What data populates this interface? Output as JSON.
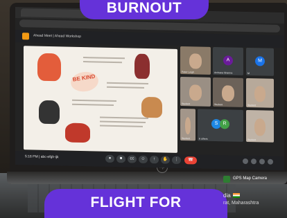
{
  "banners": {
    "top_text": "BURNOUT",
    "bottom_text": "FLIGHT FOR"
  },
  "meet": {
    "title": "Ahead Meet | Ahead Workshop",
    "clock": "5:16 PM  |  abc-efgh-ijk"
  },
  "slide": {
    "heading": "BE KIND"
  },
  "participants": [
    {
      "label": "Peter Leigh"
    },
    {
      "label": "Archana Sharma"
    },
    {
      "label": "M"
    },
    {
      "label": "Student"
    },
    {
      "label": "Student"
    },
    {
      "label": "Student"
    },
    {
      "label": "Student"
    },
    {
      "label": "6 others"
    },
    {
      "label": "Student"
    }
  ],
  "gps_overlay": {
    "app_label": "GPS Map Camera",
    "location": "dia",
    "address": "rat, Maharashtra"
  },
  "colors": {
    "banner_bg": "#6532d9",
    "end_call": "#ea4335",
    "meet_accent": "#f29a14"
  },
  "icons": [
    "mic-icon",
    "camera-icon",
    "captions-icon",
    "emoji-icon",
    "present-icon",
    "raise-hand-icon",
    "more-icon",
    "end-call-icon",
    "info-icon",
    "people-icon",
    "chat-icon",
    "activities-icon"
  ]
}
